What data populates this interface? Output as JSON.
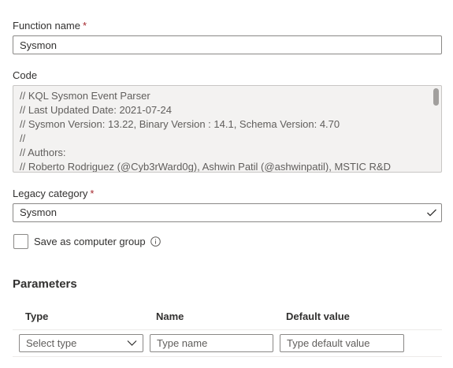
{
  "function_name": {
    "label": "Function name",
    "required_mark": "*",
    "value": "Sysmon"
  },
  "code": {
    "label": "Code",
    "lines": [
      "// KQL Sysmon Event Parser",
      "// Last Updated Date: 2021-07-24",
      "// Sysmon Version: 13.22, Binary Version : 14.1, Schema Version: 4.70",
      "//",
      "// Authors:",
      "// Roberto Rodriguez (@Cyb3rWard0g), Ashwin Patil (@ashwinpatil), MSTIC R&D"
    ]
  },
  "legacy_category": {
    "label": "Legacy category",
    "required_mark": "*",
    "value": "Sysmon"
  },
  "computer_group": {
    "label": "Save as computer group",
    "checked": false
  },
  "parameters": {
    "title": "Parameters",
    "columns": {
      "type": "Type",
      "name": "Name",
      "default_value": "Default value"
    },
    "row": {
      "type_placeholder": "Select type",
      "name_placeholder": "Type name",
      "default_placeholder": "Type default value"
    }
  },
  "icons": {
    "dropdown": "chevron-down-icon",
    "info": "info-icon",
    "checkmark": "checkmark-icon"
  }
}
